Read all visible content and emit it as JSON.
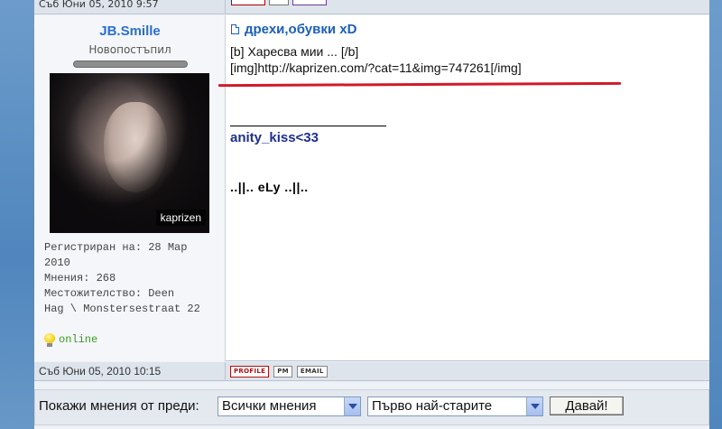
{
  "top_row": {
    "date": "Съб Юни 05, 2010 9:57"
  },
  "profile": {
    "username": "JB.Smille",
    "rank": "Новопостъпил",
    "avatar_watermark": "kaprizen",
    "info_lines": [
      "Регистриран на: 28 Мар",
      "2010",
      "Мнения: 268",
      "Местожителство: Deen",
      "Hag \\ Monstersestraat 22"
    ],
    "status": "online"
  },
  "message": {
    "subject": "дрехи,обувки xD",
    "lines": [
      "[b] Харесва мии ... [/b]",
      "[img]http://kaprizen.com/?cat=11&img=747261[/img]"
    ],
    "signature_1": "anity_kiss<33",
    "signature_2": "..||.. eLy ..||.."
  },
  "post_footer": {
    "date": "Съб Юни 05, 2010 10:15",
    "buttons": [
      "PROFILE",
      "PM",
      "EMAIL"
    ]
  },
  "filter": {
    "label": "Покажи мнения от преди:",
    "period_selected": "Всички мнения",
    "order_selected": "Първо най-старите",
    "go_label": "Давай!"
  },
  "colors": {
    "username": "#2a6fd0",
    "subject": "#1b5fb8",
    "signature": "#1e2f8c",
    "online": "#3a9a20",
    "underline": "#d11a2a"
  }
}
